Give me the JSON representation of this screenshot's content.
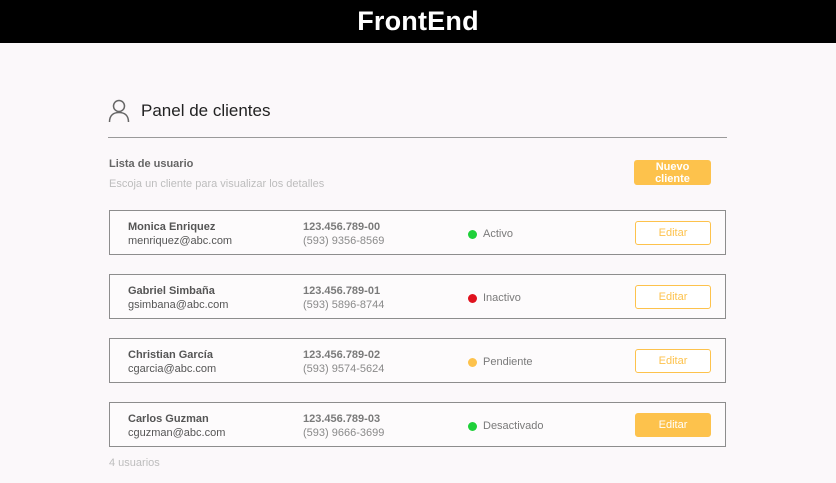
{
  "app": {
    "brand": "FrontEnd"
  },
  "panel": {
    "icon": "user-icon",
    "title": "Panel de clientes",
    "list_title": "Lista de usuario",
    "list_subtitle": "Escoja un cliente para visualizar los detalles",
    "new_button": "Nuevo cliente"
  },
  "clients": [
    {
      "name": "Monica Enriquez",
      "email": "menriquez@abc.com",
      "id": "123.456.789-00",
      "phone": "(593) 9356-8569",
      "status": "Activo",
      "status_color": "#1fd03a",
      "edit_label": "Editar",
      "edit_filled": false
    },
    {
      "name": "Gabriel Simbaña",
      "email": "gsimbana@abc.com",
      "id": "123.456.789-01",
      "phone": "(593) 5896-8744",
      "status": "Inactivo",
      "status_color": "#e0121e",
      "edit_label": "Editar",
      "edit_filled": false
    },
    {
      "name": "Christian García",
      "email": "cgarcia@abc.com",
      "id": "123.456.789-02",
      "phone": "(593) 9574-5624",
      "status": "Pendiente",
      "status_color": "#fdc24c",
      "edit_label": "Editar",
      "edit_filled": false
    },
    {
      "name": "Carlos Guzman",
      "email": "cguzman@abc.com",
      "id": "123.456.789-03",
      "phone": "(593) 9666-3699",
      "status": "Desactivado",
      "status_color": "#1fd03a",
      "edit_label": "Editar",
      "edit_filled": true
    }
  ],
  "footer": {
    "count_label": "4 usuarios"
  },
  "colors": {
    "accent": "#fdc24c",
    "topbar": "#000000"
  }
}
